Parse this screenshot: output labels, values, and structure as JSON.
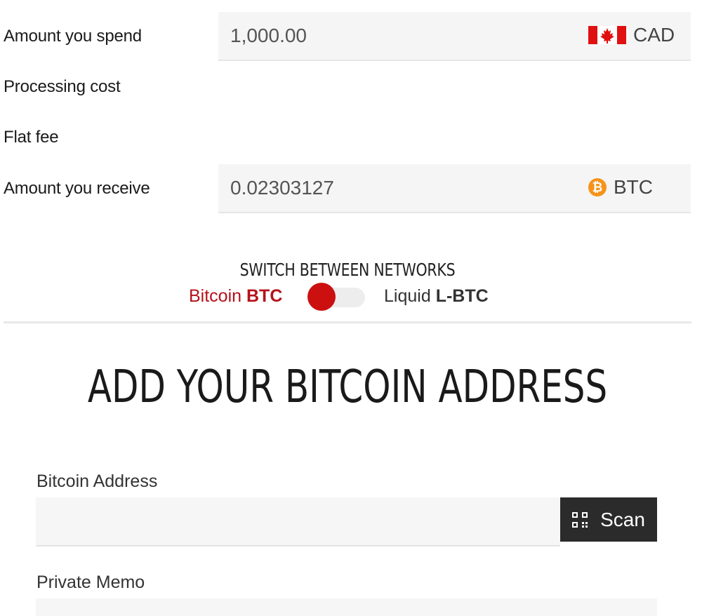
{
  "rows": {
    "spend_label": "Amount you spend",
    "processing_label": "Processing cost",
    "flat_fee_label": "Flat fee",
    "receive_label": "Amount you receive"
  },
  "spend": {
    "value": "1,000.00",
    "currency": "CAD",
    "icon": "canada-flag-icon"
  },
  "receive": {
    "value": "0.02303127",
    "currency": "BTC",
    "icon": "bitcoin-icon",
    "icon_glyph": "₿"
  },
  "network": {
    "title": "SWITCH BETWEEN NETWORKS",
    "left_name": "Bitcoin",
    "left_ticker": "BTC",
    "right_name": "Liquid",
    "right_ticker": "L-BTC",
    "selected": "Bitcoin BTC",
    "accent": "#cc1010"
  },
  "address_section": {
    "heading": "ADD YOUR BITCOIN ADDRESS",
    "address_label": "Bitcoin Address",
    "address_value": "",
    "scan_label": "Scan",
    "memo_label": "Private Memo",
    "memo_value": ""
  }
}
